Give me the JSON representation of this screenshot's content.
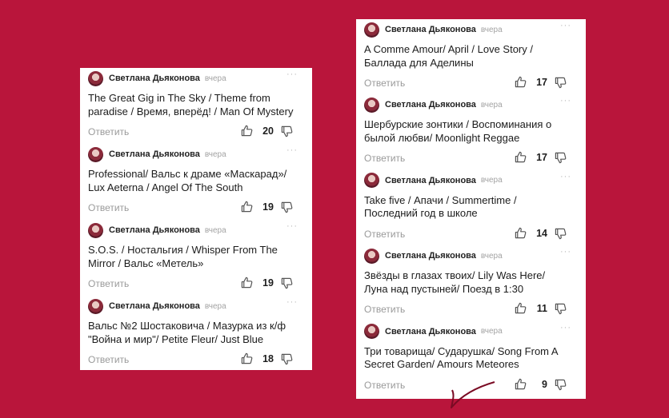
{
  "left_column": [
    {
      "author": "Светлана Дьяконова",
      "time": "вчера",
      "more": "···",
      "line1": "The Great Gig in The Sky /  Theme from",
      "line2": "paradise / Время, вперёд! / Man Of Mystery",
      "reply": "Ответить",
      "likes": "20"
    },
    {
      "author": "Светлана Дьяконова",
      "time": "вчера",
      "more": "···",
      "line1": "Professional/ Вальс к драме «Маскарад»/",
      "line2": "Lux Aeterna / Angel Of The South",
      "reply": "Ответить",
      "likes": "19"
    },
    {
      "author": "Светлана Дьяконова",
      "time": "вчера",
      "more": "···",
      "line1": "S.O.S.  / Ностальгия / Whisper From The",
      "line2": "Mirror / Вальс «Метель»",
      "reply": "Ответить",
      "likes": "19"
    },
    {
      "author": "Светлана Дьяконова",
      "time": "вчера",
      "more": "···",
      "line1": "Вальс №2 Шостаковича / Мазурка из к/ф",
      "line2": "\"Война и мир\"/ Petite Fleur/ Just Blue",
      "reply": "Ответить",
      "likes": "18"
    }
  ],
  "right_column": [
    {
      "author": "Светлана Дьяконова",
      "time": "вчера",
      "more": "···",
      "line1": "A Comme Amour/ April / Love Story /",
      "line2": "Баллада для Аделины",
      "reply": "Ответить",
      "likes": "17"
    },
    {
      "author": "Светлана Дьяконова",
      "time": "вчера",
      "more": "···",
      "line1": "Шербурские зонтики / Воспоминания о",
      "line2": "былой любви/ Moonlight Reggae",
      "reply": "Ответить",
      "likes": "17"
    },
    {
      "author": "Светлана Дьяконова",
      "time": "вчера",
      "more": "···",
      "line1": "Take five / Апачи / Summertime /",
      "line2": "Последний год в школе",
      "reply": "Ответить",
      "likes": "14"
    },
    {
      "author": "Светлана Дьяконова",
      "time": "вчера",
      "more": "···",
      "line1": "Звёзды в глазах твоих/ Lily Was Here/",
      "line2": "Луна над пустыней/ Поезд в 1:30",
      "reply": "Ответить",
      "likes": "11"
    },
    {
      "author": "Светлана Дьяконова",
      "time": "вчера",
      "more": "···",
      "line1": "Три товарища/ Сударушка/ Song From A",
      "line2": "Secret Garden/ Amours Meteores",
      "reply": "Ответить",
      "likes": "9"
    }
  ],
  "colors": {
    "background": "#b9153b",
    "panel": "#ffffff",
    "muted": "#9a9a9a"
  },
  "icons": {
    "like": "thumbs-up-icon",
    "dislike": "thumbs-down-icon",
    "more": "more-dots-icon",
    "avatar": "user-avatar"
  }
}
